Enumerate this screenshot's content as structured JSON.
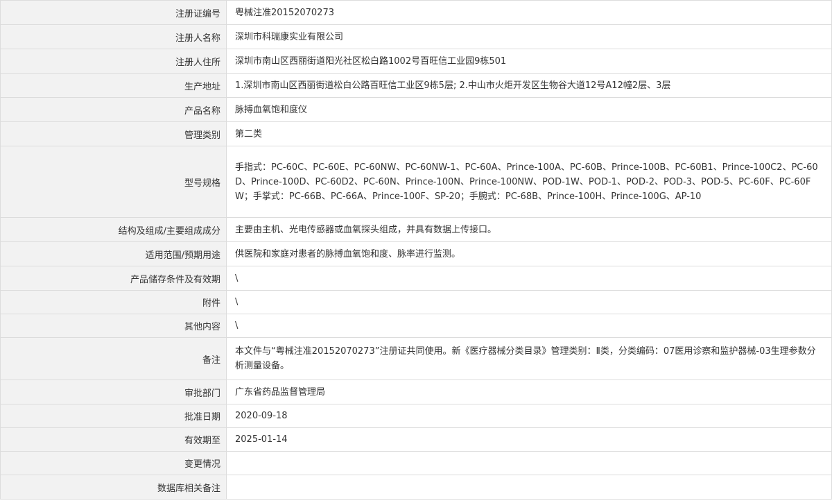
{
  "rows": [
    {
      "label": "注册证编号",
      "value": "粤械注准20152070273"
    },
    {
      "label": "注册人名称",
      "value": "深圳市科瑞康实业有限公司"
    },
    {
      "label": "注册人住所",
      "value": "深圳市南山区西丽街道阳光社区松白路1002号百旺信工业园9栋501"
    },
    {
      "label": "生产地址",
      "value": "1.深圳市南山区西丽街道松白公路百旺信工业区9栋5层; 2.中山市火炬开发区生物谷大道12号A12幢2层、3层"
    },
    {
      "label": "产品名称",
      "value": "脉搏血氧饱和度仪"
    },
    {
      "label": "管理类别",
      "value": "第二类"
    },
    {
      "label": "型号规格",
      "value": "手指式：PC-60C、PC-60E、PC-60NW、PC-60NW-1、PC-60A、Prince-100A、PC-60B、Prince-100B、PC-60B1、Prince-100C2、PC-60D、Prince-100D、PC-60D2、PC-60N、Prince-100N、Prince-100NW、POD-1W、POD-1、POD-2、POD-3、POD-5、PC-60F、PC-60FW；手掌式：PC-66B、PC-66A、Prince-100F、SP-20；手腕式：PC-68B、Prince-100H、Prince-100G、AP-10"
    },
    {
      "label": "结构及组成/主要组成成分",
      "value": "主要由主机、光电传感器或血氧探头组成，并具有数据上传接口。"
    },
    {
      "label": "适用范围/预期用途",
      "value": "供医院和家庭对患者的脉搏血氧饱和度、脉率进行监测。"
    },
    {
      "label": "产品储存条件及有效期",
      "value": "\\"
    },
    {
      "label": "附件",
      "value": "\\"
    },
    {
      "label": "其他内容",
      "value": "\\"
    },
    {
      "label": "备注",
      "value": "本文件与“粤械注准20152070273”注册证共同使用。新《医疗器械分类目录》管理类别：Ⅱ类，分类编码：07医用诊察和监护器械-03生理参数分析测量设备。"
    },
    {
      "label": "审批部门",
      "value": "广东省药品监督管理局"
    },
    {
      "label": "批准日期",
      "value": "2020-09-18"
    },
    {
      "label": "有效期至",
      "value": "2025-01-14"
    },
    {
      "label": "变更情况",
      "value": ""
    },
    {
      "label": "数据库相关备注",
      "value": ""
    }
  ]
}
